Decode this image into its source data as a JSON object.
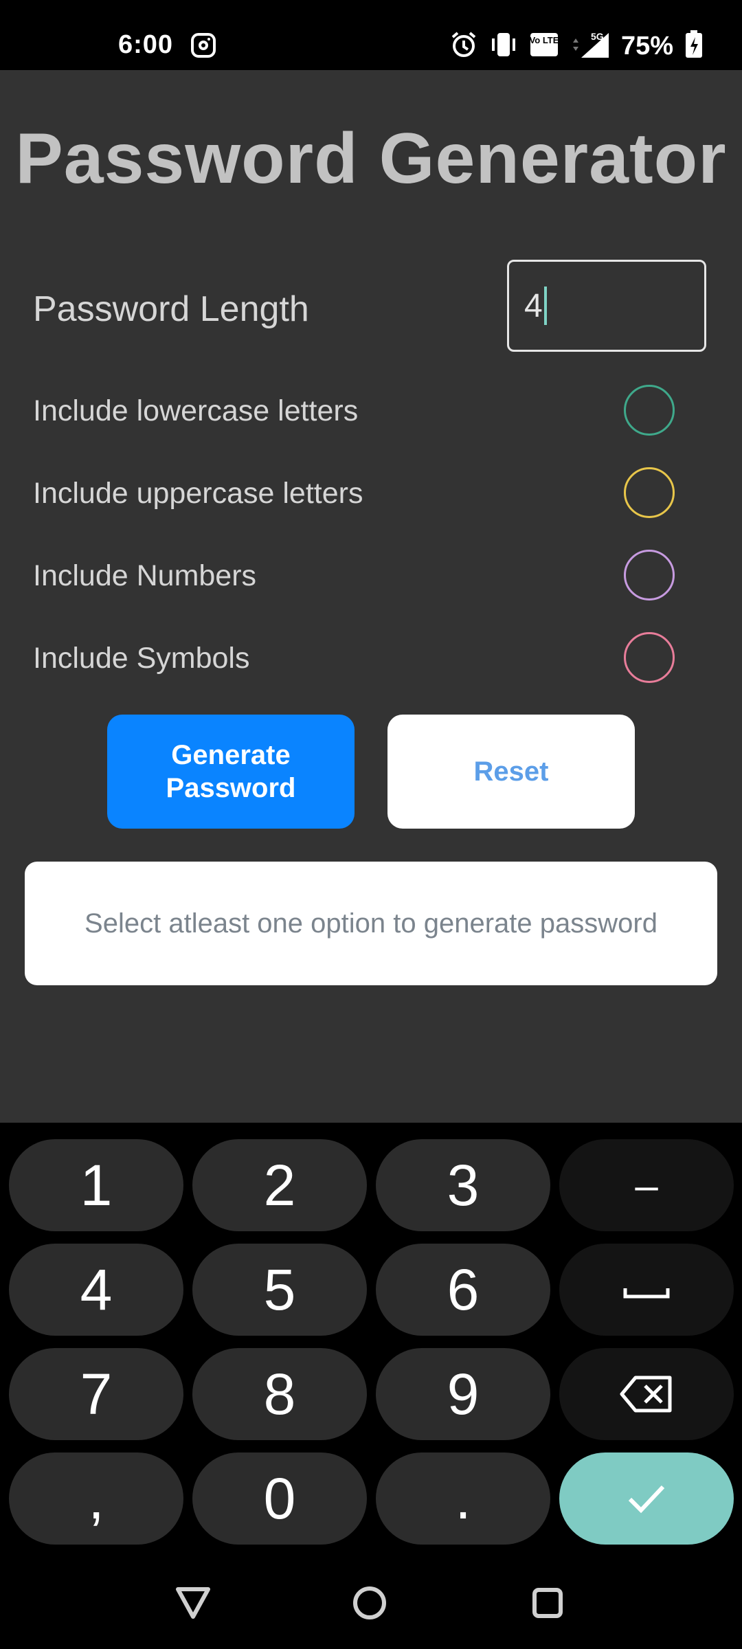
{
  "status_bar": {
    "time": "6:00",
    "battery_percent": "75%",
    "signal_label": "5G",
    "volte_label": "Vo LTE"
  },
  "app": {
    "title": "Password Generator",
    "length_label": "Password Length",
    "length_value": "4",
    "options": [
      {
        "label": "Include lowercase letters",
        "color": "#3fa98b"
      },
      {
        "label": "Include uppercase letters",
        "color": "#e8c64a"
      },
      {
        "label": "Include Numbers",
        "color": "#c79be0"
      },
      {
        "label": "Include Symbols",
        "color": "#e87d9a"
      }
    ],
    "generate_label": "Generate Password",
    "reset_label": "Reset",
    "message": "Select atleast one option to generate password"
  },
  "keyboard": {
    "keys": [
      "1",
      "2",
      "3",
      "–",
      "4",
      "5",
      "6",
      "␣",
      "7",
      "8",
      "9",
      "⌫",
      ",",
      "0",
      ".",
      "✓"
    ]
  },
  "navbar": {
    "back_icon": "triangle-back-icon",
    "home_icon": "circle-home-icon",
    "recents_icon": "square-recents-icon"
  }
}
